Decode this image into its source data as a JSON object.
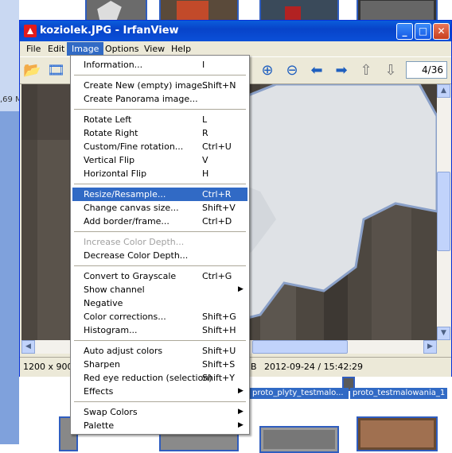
{
  "background": {
    "size_text": ",69 M",
    "thumb_labels": [
      "proto_plyty_testmalo...",
      "proto_testmalowania_1"
    ]
  },
  "window": {
    "title": "koziolek.JPG - IrfanView",
    "menus": [
      "File",
      "Edit",
      "Image",
      "Options",
      "View",
      "Help"
    ],
    "active_menu": "Image",
    "page_counter": "4/36",
    "status": {
      "dimensions": "1200 x 900",
      "size_fragment": "B",
      "datetime": "2012-09-24 / 15:42:29"
    }
  },
  "image_menu": {
    "items": [
      {
        "label": "Information...",
        "shortcut": "I"
      },
      {
        "label": "Create New (empty) image...",
        "shortcut": "Shift+N"
      },
      {
        "label": "Create Panorama image...",
        "shortcut": ""
      },
      {
        "label": "Rotate Left",
        "shortcut": "L"
      },
      {
        "label": "Rotate Right",
        "shortcut": "R"
      },
      {
        "label": "Custom/Fine rotation...",
        "shortcut": "Ctrl+U"
      },
      {
        "label": "Vertical Flip",
        "shortcut": "V"
      },
      {
        "label": "Horizontal Flip",
        "shortcut": "H"
      },
      {
        "label": "Resize/Resample...",
        "shortcut": "Ctrl+R"
      },
      {
        "label": "Change canvas size...",
        "shortcut": "Shift+V"
      },
      {
        "label": "Add border/frame...",
        "shortcut": "Ctrl+D"
      },
      {
        "label": "Increase Color Depth...",
        "shortcut": ""
      },
      {
        "label": "Decrease Color Depth...",
        "shortcut": ""
      },
      {
        "label": "Convert to Grayscale",
        "shortcut": "Ctrl+G"
      },
      {
        "label": "Show channel",
        "shortcut": ""
      },
      {
        "label": "Negative",
        "shortcut": ""
      },
      {
        "label": "Color corrections...",
        "shortcut": "Shift+G"
      },
      {
        "label": "Histogram...",
        "shortcut": "Shift+H"
      },
      {
        "label": "Auto adjust colors",
        "shortcut": "Shift+U"
      },
      {
        "label": "Sharpen",
        "shortcut": "Shift+S"
      },
      {
        "label": "Red eye reduction (selection)",
        "shortcut": "Shift+Y"
      },
      {
        "label": "Effects",
        "shortcut": ""
      },
      {
        "label": "Swap Colors",
        "shortcut": ""
      },
      {
        "label": "Palette",
        "shortcut": ""
      }
    ]
  }
}
